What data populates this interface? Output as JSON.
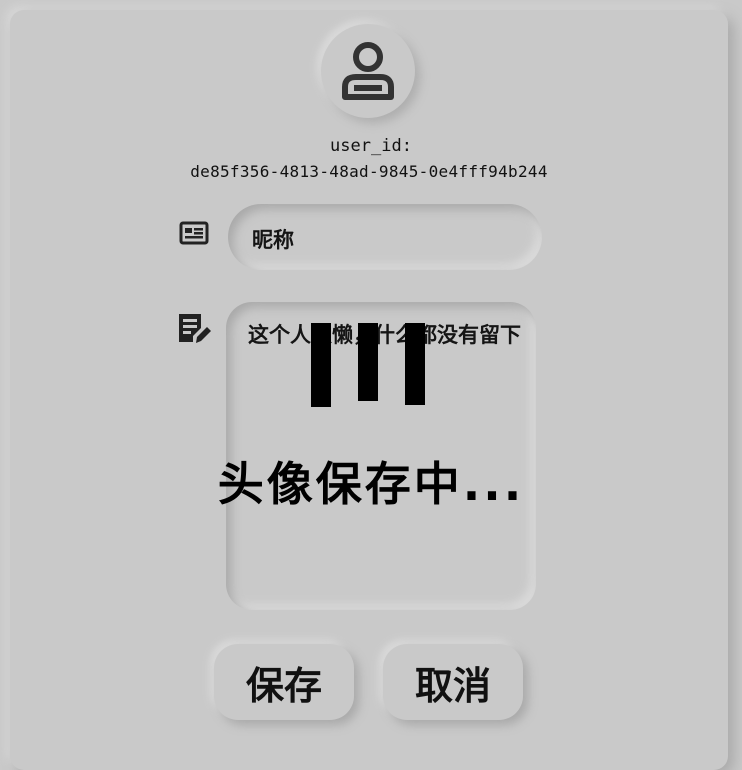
{
  "profile": {
    "avatar_icon": "user-avatar-icon",
    "user_id_label": "user_id:",
    "user_id_value": "de85f356-4813-48ad-9845-0e4fff94b244"
  },
  "form": {
    "nickname_icon": "id-card-icon",
    "nickname_value": "昵称",
    "bio_icon": "edit-note-icon",
    "bio_value": "这个人很懒，什么都没有留下"
  },
  "overlay": {
    "message": "头像保存中..."
  },
  "actions": {
    "save_label": "保存",
    "cancel_label": "取消"
  },
  "colors": {
    "background": "#c9c9c9",
    "text": "#111111"
  }
}
